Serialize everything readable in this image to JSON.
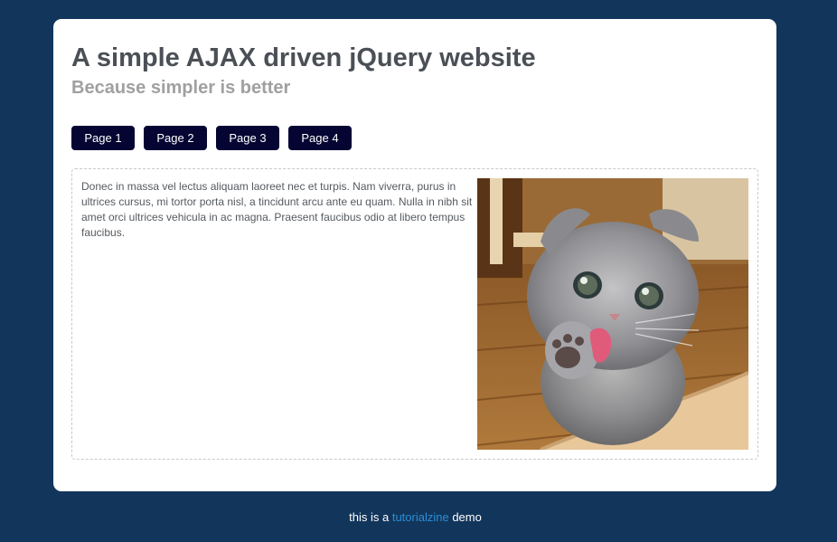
{
  "header": {
    "title": "A simple AJAX driven jQuery website",
    "subtitle": "Because simpler is better"
  },
  "nav": {
    "buttons": [
      {
        "label": "Page 1"
      },
      {
        "label": "Page 2"
      },
      {
        "label": "Page 3"
      },
      {
        "label": "Page 4"
      }
    ]
  },
  "content": {
    "text": "Donec in massa vel lectus aliquam laoreet nec et turpis. Nam viverra, purus in ultrices cursus, mi tortor porta nisl, a tincidunt arcu ante eu quam. Nulla in nibh sit amet orci ultrices vehicula in ac magna. Praesent faucibus odio at libero tempus faucibus.",
    "image": "kitten-photo"
  },
  "footer": {
    "prefix": "this is a ",
    "link": "tutorialzine",
    "suffix": " demo"
  },
  "colors": {
    "background": "#12355b",
    "button": "#050533",
    "link": "#2a8fd6"
  }
}
